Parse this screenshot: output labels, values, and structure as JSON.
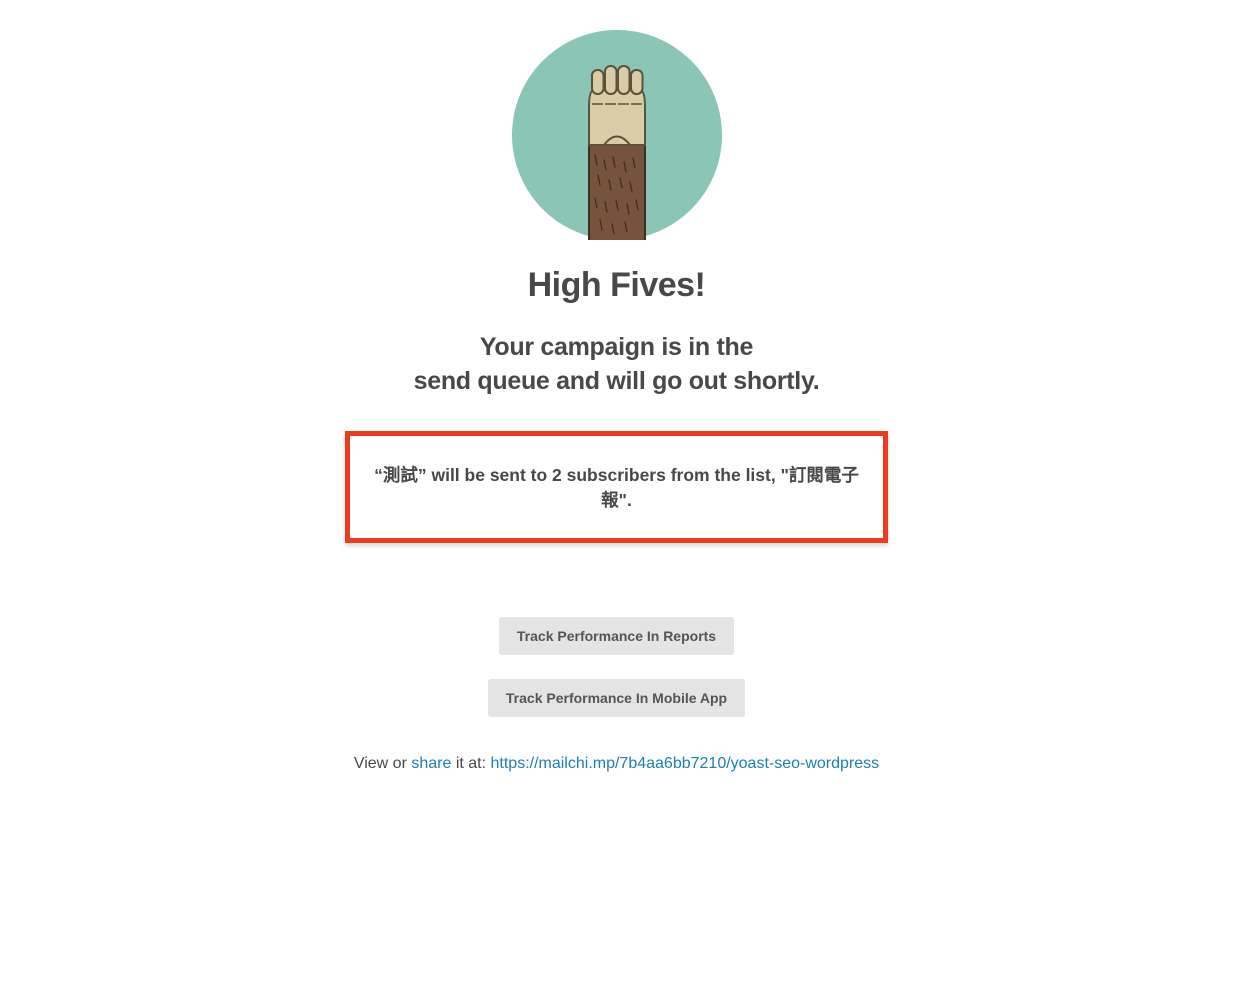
{
  "heading": "High Fives!",
  "subheading_line1": "Your campaign is in the",
  "subheading_line2": "send queue and will go out shortly.",
  "highlight": {
    "campaign_name": "測試",
    "subscriber_count": "2",
    "list_name": "訂閱電子報",
    "full_text": "“測試” will be sent to 2 subscribers from the list, \"訂閱電子報\"."
  },
  "buttons": {
    "track_reports": "Track Performance In Reports",
    "track_mobile": "Track Performance In Mobile App"
  },
  "footer": {
    "prefix": "View or ",
    "share_label": "share",
    "mid": " it at: ",
    "url": "https://mailchi.mp/7b4aa6bb7210/yoast-seo-wordpress"
  }
}
